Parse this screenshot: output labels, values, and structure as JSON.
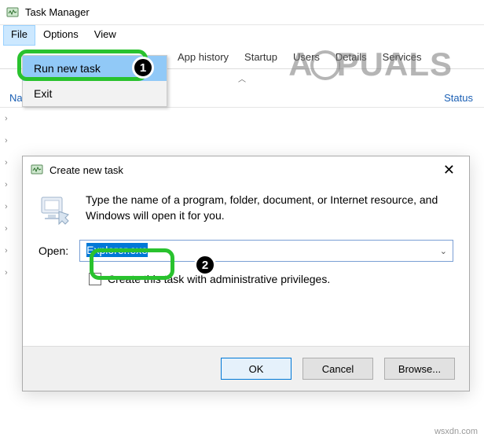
{
  "window": {
    "title": "Task Manager"
  },
  "menubar": {
    "file": "File",
    "options": "Options",
    "view": "View"
  },
  "file_menu": {
    "run_new_task": "Run new task",
    "exit": "Exit"
  },
  "tabs": {
    "app_history": "App history",
    "startup": "Startup",
    "users": "Users",
    "details": "Details",
    "services": "Services"
  },
  "columns": {
    "name": "Name",
    "status": "Status"
  },
  "dialog": {
    "title": "Create new task",
    "message": "Type the name of a program, folder, document, or Internet resource, and Windows will open it for you.",
    "open_label": "Open:",
    "open_value": "Explorer.exe",
    "admin_label": "Create this task with administrative privileges.",
    "ok": "OK",
    "cancel": "Cancel",
    "browse": "Browse..."
  },
  "watermark": {
    "text_left": "A",
    "text_right": "PUALS"
  },
  "credit": "wsxdn.com",
  "badges": {
    "one": "1",
    "two": "2"
  },
  "collapse_glyph": "︿"
}
